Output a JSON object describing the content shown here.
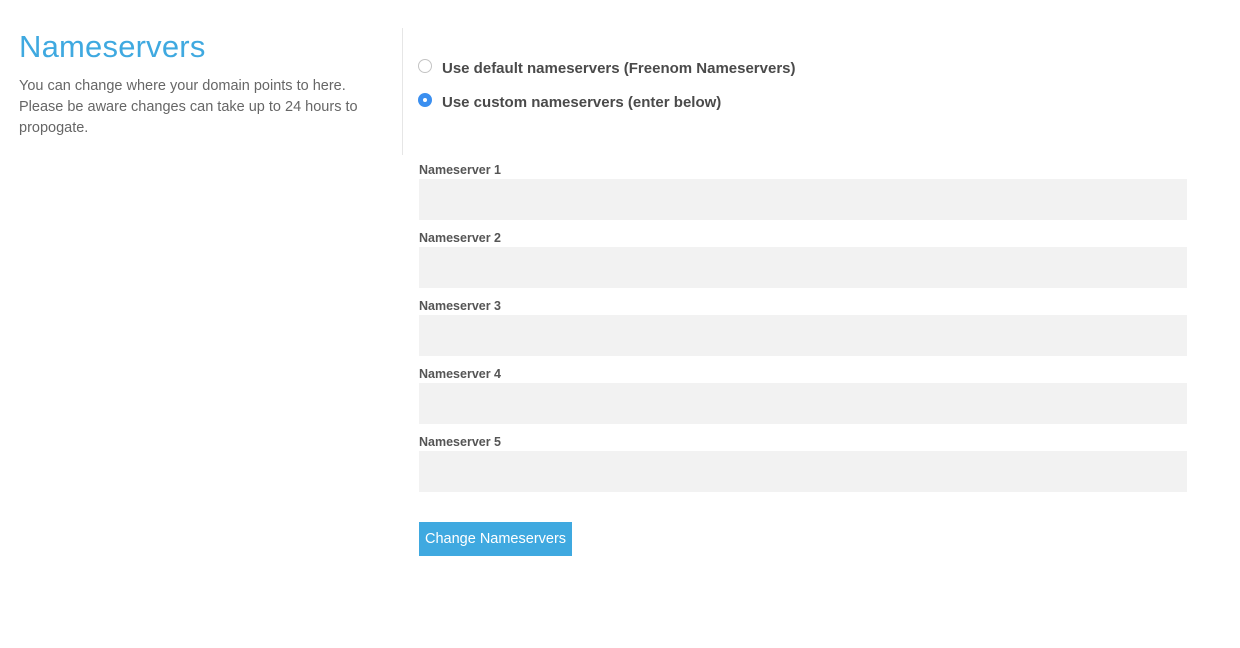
{
  "intro": {
    "title": "Nameservers",
    "description_lines": [
      "You can change where your domain points to here.",
      "Please be aware changes can take up to 24 hours to",
      "propogate."
    ]
  },
  "options": [
    {
      "label": "Use default nameservers (Freenom Nameservers)",
      "selected": false
    },
    {
      "label": "Use custom nameservers (enter below)",
      "selected": true
    }
  ],
  "fields": [
    {
      "label": "Nameserver 1",
      "value": ""
    },
    {
      "label": "Nameserver 2",
      "value": ""
    },
    {
      "label": "Nameserver 3",
      "value": ""
    },
    {
      "label": "Nameserver 4",
      "value": ""
    },
    {
      "label": "Nameserver 5",
      "value": ""
    }
  ],
  "submit_label": "Change Nameservers",
  "colors": {
    "accent": "#3fa9e0",
    "radio_selected": "#3b8ff0",
    "input_bg": "#f2f2f2"
  }
}
